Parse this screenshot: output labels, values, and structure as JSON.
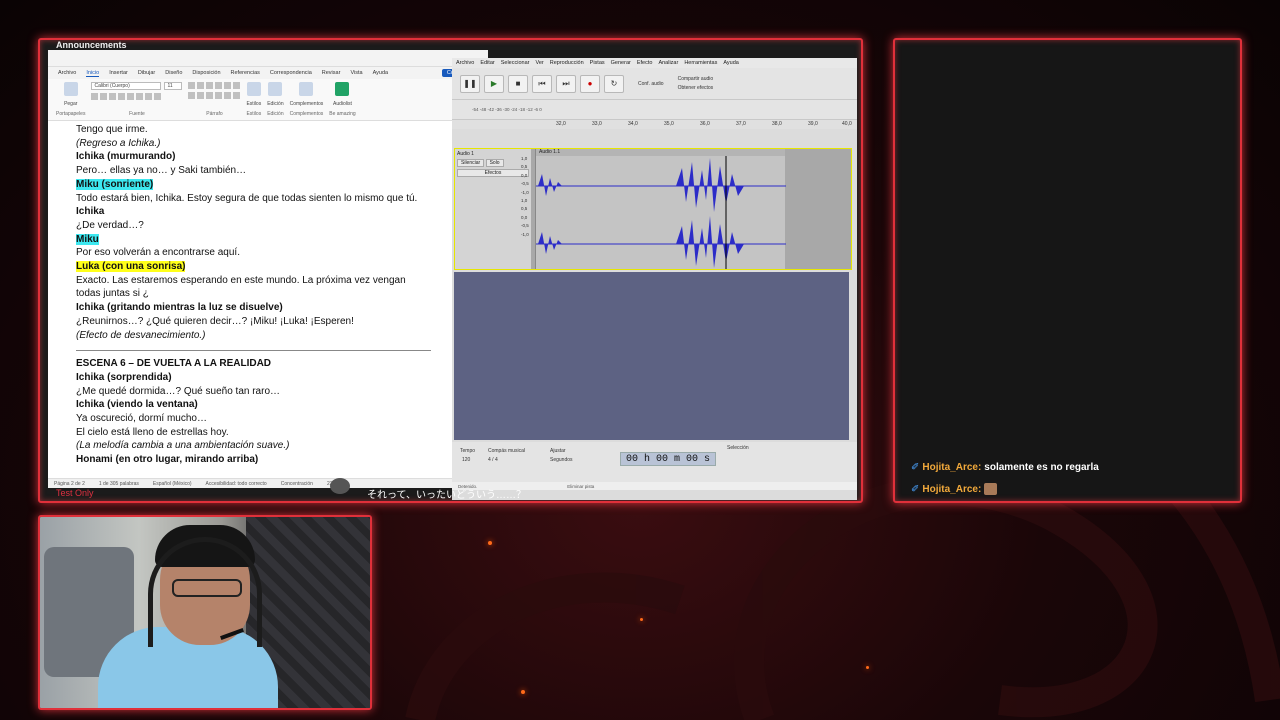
{
  "overlay": {
    "announcements": "Announcements",
    "test_only": "Test Only",
    "subtitle": "それって、いったいどういう……？"
  },
  "word": {
    "tabs": [
      "Archivo",
      "Inicio",
      "Insertar",
      "Dibujar",
      "Diseño",
      "Disposición",
      "Referencias",
      "Correspondencia",
      "Revisar",
      "Vista",
      "Ayuda"
    ],
    "share_label": "Compartir",
    "font_name": "Calibri (Cuerpo)",
    "font_size": "11",
    "ribbon_groups": [
      "Portapapeles",
      "Fuente",
      "Párrafo",
      "Estilos",
      "Edición",
      "Complementos",
      "Be amazing"
    ],
    "ribbon_buttons": [
      "Pegar",
      "Estilos",
      "Edición",
      "Complementos",
      "Audiolist"
    ],
    "lines": [
      {
        "text": "Tengo que irme.",
        "style": "normal"
      },
      {
        "text": "(Regreso a Ichika.)",
        "style": "italic"
      },
      {
        "text": "Ichika (murmurando)",
        "style": "bold"
      },
      {
        "text": "Pero… ellas ya no… y Saki también…",
        "style": "normal"
      },
      {
        "text": "Miku (sonriente)",
        "style": "cyan"
      },
      {
        "text": "Todo estará bien, Ichika. Estoy segura de que todas sienten lo mismo que tú.",
        "style": "normal"
      },
      {
        "text": "Ichika",
        "style": "bold"
      },
      {
        "text": "¿De verdad…?",
        "style": "normal"
      },
      {
        "text": "Miku",
        "style": "cyan"
      },
      {
        "text": "Por eso volverán a encontrarse aquí.",
        "style": "normal"
      },
      {
        "text": "Luka (con una sonrisa)",
        "style": "yellow"
      },
      {
        "text": "Exacto. Las estaremos esperando en este mundo. La próxima vez vengan",
        "style": "normal"
      },
      {
        "text": "todas juntas si ¿",
        "style": "normal"
      },
      {
        "text": "Ichika (gritando mientras la luz se disuelve)",
        "style": "bold"
      },
      {
        "text": "¿Reunirnos…? ¿Qué quieren decir…? ¡Miku! ¡Luka! ¡Esperen!",
        "style": "normal"
      },
      {
        "text": "(Efecto de desvanecimiento.)",
        "style": "italic"
      }
    ],
    "lines2": [
      {
        "text": "ESCENA 6 – DE VUELTA A LA REALIDAD",
        "style": "bold"
      },
      {
        "text": "Ichika (sorprendida)",
        "style": "bold"
      },
      {
        "text": "¿Me quedé dormida…? Qué sueño tan raro…",
        "style": "normal"
      },
      {
        "text": "Ichika (viendo la ventana)",
        "style": "bold"
      },
      {
        "text": "Ya oscureció, dormí mucho…",
        "style": "normal"
      },
      {
        "text": "El cielo está lleno de estrellas hoy.",
        "style": "normal"
      },
      {
        "text": "(La melodía cambia a una ambientación suave.)",
        "style": "italic"
      },
      {
        "text": "Honami (en otro lugar, mirando arriba)",
        "style": "bold"
      }
    ],
    "status": [
      "Página 2 de 2",
      "1 de 305 palabras",
      "Español (México)",
      "Accesibilidad: todo correcto",
      "Concentración",
      "230%"
    ]
  },
  "audacity": {
    "menu": [
      "Archivo",
      "Editar",
      "Seleccionar",
      "Ver",
      "Reproducción",
      "Pistas",
      "Generar",
      "Efecto",
      "Analizar",
      "Herramientas",
      "Ayuda"
    ],
    "audio_setup": "Conf. audio",
    "share_audio": "Compartir audio",
    "get_effects": "Obtener efectos",
    "ruler": [
      "32,0",
      "33,0",
      "34,0",
      "35,0",
      "36,0",
      "37,0",
      "38,0",
      "39,0",
      "40,0"
    ],
    "track_name": "Audio 1",
    "clip_name": "Audio 1.1",
    "mute": "Silenciar",
    "solo": "Solo",
    "effects": "Efectos",
    "scale": [
      "1,0",
      "0,5",
      "0,0",
      "-0,5",
      "-1,0",
      "1,0",
      "0,5",
      "0,0",
      "-0,5",
      "-1,0"
    ],
    "tempo_label": "Tempo",
    "tempo_value": "120",
    "meter_label": "Compás musical",
    "meter_value": "4 / 4",
    "snap_label": "Ajustar",
    "snap_unit": "Segundos",
    "time": "00 h 00 m 00 s",
    "selection_label": "Selección",
    "status_left": "Detenido.",
    "status_mid": "Eliminar pista"
  },
  "chat": {
    "messages": [
      {
        "user": "Hojita_Arce:",
        "text": "solamente es no regarla",
        "emote": false
      },
      {
        "user": "Hojita_Arce:",
        "text": "",
        "emote": true
      }
    ]
  },
  "colors": {
    "frame_border": "#e0303a",
    "chat_user": "#f2a93b",
    "highlight_cyan": "#3de8f0",
    "highlight_yellow": "#ffff1a",
    "waveform": "#2c2cc8"
  }
}
